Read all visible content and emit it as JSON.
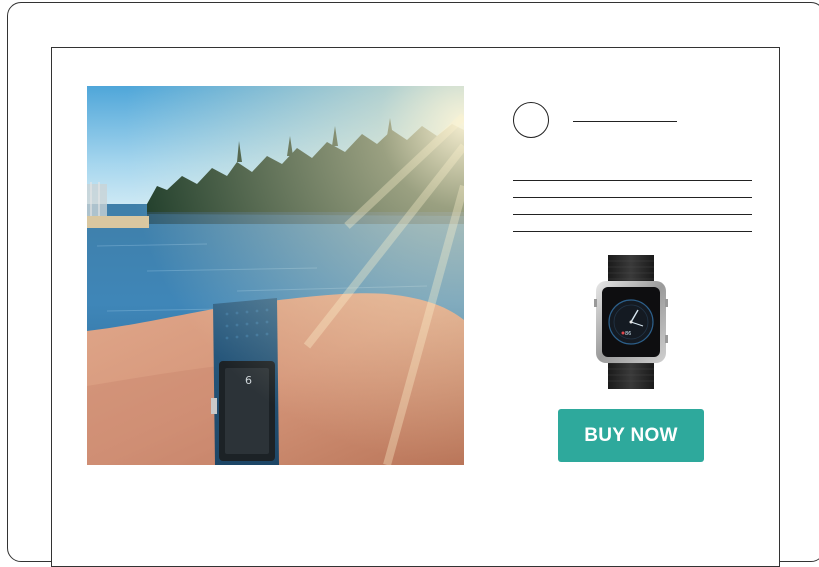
{
  "post": {
    "buy_button_label": "BUY NOW"
  },
  "colors": {
    "button_bg": "#2ea99c",
    "button_text": "#ffffff",
    "outline": "#333333"
  },
  "icons": {
    "avatar": "avatar-placeholder-circle",
    "product": "smartwatch-product-image",
    "photo": "lake-wrist-fitness-tracker-photo"
  }
}
